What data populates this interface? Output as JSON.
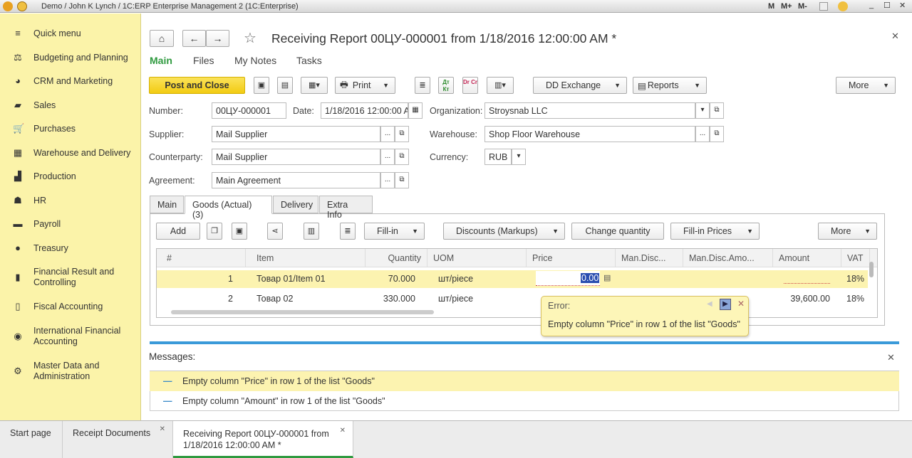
{
  "window": {
    "title": "Demo / John K Lynch / 1C:ERP Enterprise Management 2  (1C:Enterprise)",
    "toolbar_icons": [
      "M",
      "M+",
      "M-"
    ]
  },
  "sidebar": {
    "items": [
      {
        "label": "Quick menu",
        "icon": "menu-icon"
      },
      {
        "label": "Budgeting and Planning",
        "icon": "budget-icon"
      },
      {
        "label": "CRM and Marketing",
        "icon": "pie-icon"
      },
      {
        "label": "Sales",
        "icon": "bag-icon"
      },
      {
        "label": "Purchases",
        "icon": "cart-icon"
      },
      {
        "label": "Warehouse and Delivery",
        "icon": "warehouse-icon"
      },
      {
        "label": "Production",
        "icon": "factory-icon"
      },
      {
        "label": "HR",
        "icon": "people-icon"
      },
      {
        "label": "Payroll",
        "icon": "wallet-icon"
      },
      {
        "label": "Treasury",
        "icon": "coin-icon"
      },
      {
        "label": "Financial Result and Controlling",
        "icon": "chart-icon"
      },
      {
        "label": "Fiscal Accounting",
        "icon": "book-icon"
      },
      {
        "label": "International Financial Accounting",
        "icon": "globe-icon"
      },
      {
        "label": "Master Data and Administration",
        "icon": "gear-icon"
      }
    ]
  },
  "document": {
    "title": "Receiving Report 00ЦУ-000001 from 1/18/2016 12:00:00 AM *",
    "nav_tabs": [
      "Main",
      "Files",
      "My Notes",
      "Tasks"
    ],
    "toolbar": {
      "post_close": "Post and Close",
      "print": "Print",
      "dd_exchange": "DD Exchange",
      "reports": "Reports",
      "more": "More",
      "dtkt": "Дт Кт",
      "drcr": "Dr Cr"
    },
    "fields": {
      "number_label": "Number:",
      "number": "00ЦУ-000001",
      "date_label": "Date:",
      "date": "1/18/2016 12:00:00 AM",
      "organization_label": "Organization:",
      "organization": "Stroysnab LLC",
      "supplier_label": "Supplier:",
      "supplier": "Mail Supplier",
      "warehouse_label": "Warehouse:",
      "warehouse": "Shop Floor Warehouse",
      "counterparty_label": "Counterparty:",
      "counterparty": "Mail Supplier",
      "currency_label": "Currency:",
      "currency": "RUB",
      "agreement_label": "Agreement:",
      "agreement": "Main Agreement"
    },
    "tabs": [
      "Main",
      "Goods (Actual) (3)",
      "Delivery",
      "Extra Info"
    ],
    "goods_toolbar": {
      "add": "Add",
      "fill_in": "Fill-in",
      "discounts": "Discounts (Markups)",
      "change_quantity": "Change quantity",
      "fill_in_prices": "Fill-in Prices",
      "more": "More"
    },
    "table": {
      "columns": [
        "#",
        "Item",
        "Quantity",
        "UOM",
        "Price",
        "Man.Disc...",
        "Man.Disc.Amo...",
        "Amount",
        "VAT"
      ],
      "rows": [
        {
          "n": "1",
          "item": "Товар 01/Item 01",
          "qty": "70.000",
          "uom": "шт/piece",
          "price": "0.00",
          "amount": "",
          "vat": "18%"
        },
        {
          "n": "2",
          "item": "Товар 02",
          "qty": "330.000",
          "uom": "шт/piece",
          "price": "",
          "amount": "39,600.00",
          "vat": "18%"
        }
      ]
    },
    "error_tooltip": {
      "title": "Error:",
      "text": "Empty column \"Price\" in row 1 of the list \"Goods\""
    }
  },
  "messages": {
    "title": "Messages:",
    "items": [
      "Empty column \"Price\" in row 1 of the list \"Goods\"",
      "Empty column \"Amount\" in row 1 of the list \"Goods\""
    ]
  },
  "bottom_tabs": [
    "Start page",
    "Receipt Documents",
    "Receiving Report 00ЦУ-000001 from 1/18/2016 12:00:00 AM *"
  ],
  "colors": {
    "sidebar": "#fbf3a9",
    "accent_button": "#f7d51d",
    "active_tab": "#2f9a3f",
    "selected_row": "#fcf3b0",
    "message_bar": "#3a9ad9"
  }
}
